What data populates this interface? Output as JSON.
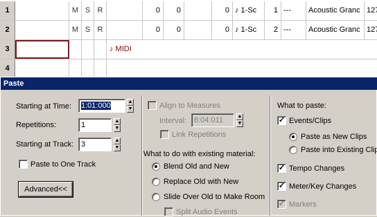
{
  "tracks": [
    {
      "num": "1",
      "m": "M",
      "s": "S",
      "r": "R",
      "v1": "0",
      "v2": "0",
      "v3": "0",
      "src": "♪ 1-Sc",
      "ch": "1",
      "patch_bank": "---",
      "patch": "Acoustic Granc",
      "vol": "127"
    },
    {
      "num": "2",
      "m": "M",
      "s": "S",
      "r": "R",
      "v1": "0",
      "v2": "0",
      "v3": "0",
      "src": "♪ 1-Sc",
      "ch": "2",
      "patch_bank": "---",
      "patch": "Acoustic Granc",
      "vol": "127"
    },
    {
      "num": "3",
      "midi": "♪ MIDI"
    },
    {
      "num": "4"
    }
  ],
  "dialog": {
    "title": "Paste",
    "starting_at_time_label": "Starting at Time:",
    "starting_at_time_value": "1:01:000",
    "repetitions_label": "Repetitions:",
    "repetitions_value": "1",
    "starting_at_track_label": "Starting at Track:",
    "starting_at_track_value": "3",
    "paste_to_one_track_label": "Paste to One Track",
    "advanced_label": "Advanced<<",
    "align_to_measures_label": "Align to Measures",
    "interval_label": "Interval:",
    "interval_value": "6:04:011",
    "link_repetitions_label": "Link Repetitions",
    "existing_material_label": "What to do with existing material:",
    "blend_label": "Blend Old and New",
    "replace_label": "Replace Old with New",
    "slide_label": "Slide Over Old to Make Room",
    "split_audio_label": "Split Audio Events",
    "what_to_paste_label": "What to paste:",
    "events_clips_label": "Events/Clips",
    "paste_new_clips_label": "Paste as New Clips",
    "paste_existing_clips_label": "Paste into Existing Clips",
    "tempo_changes_label": "Tempo Changes",
    "meter_key_label": "Meter/Key Changes",
    "markers_label": "Markers"
  }
}
